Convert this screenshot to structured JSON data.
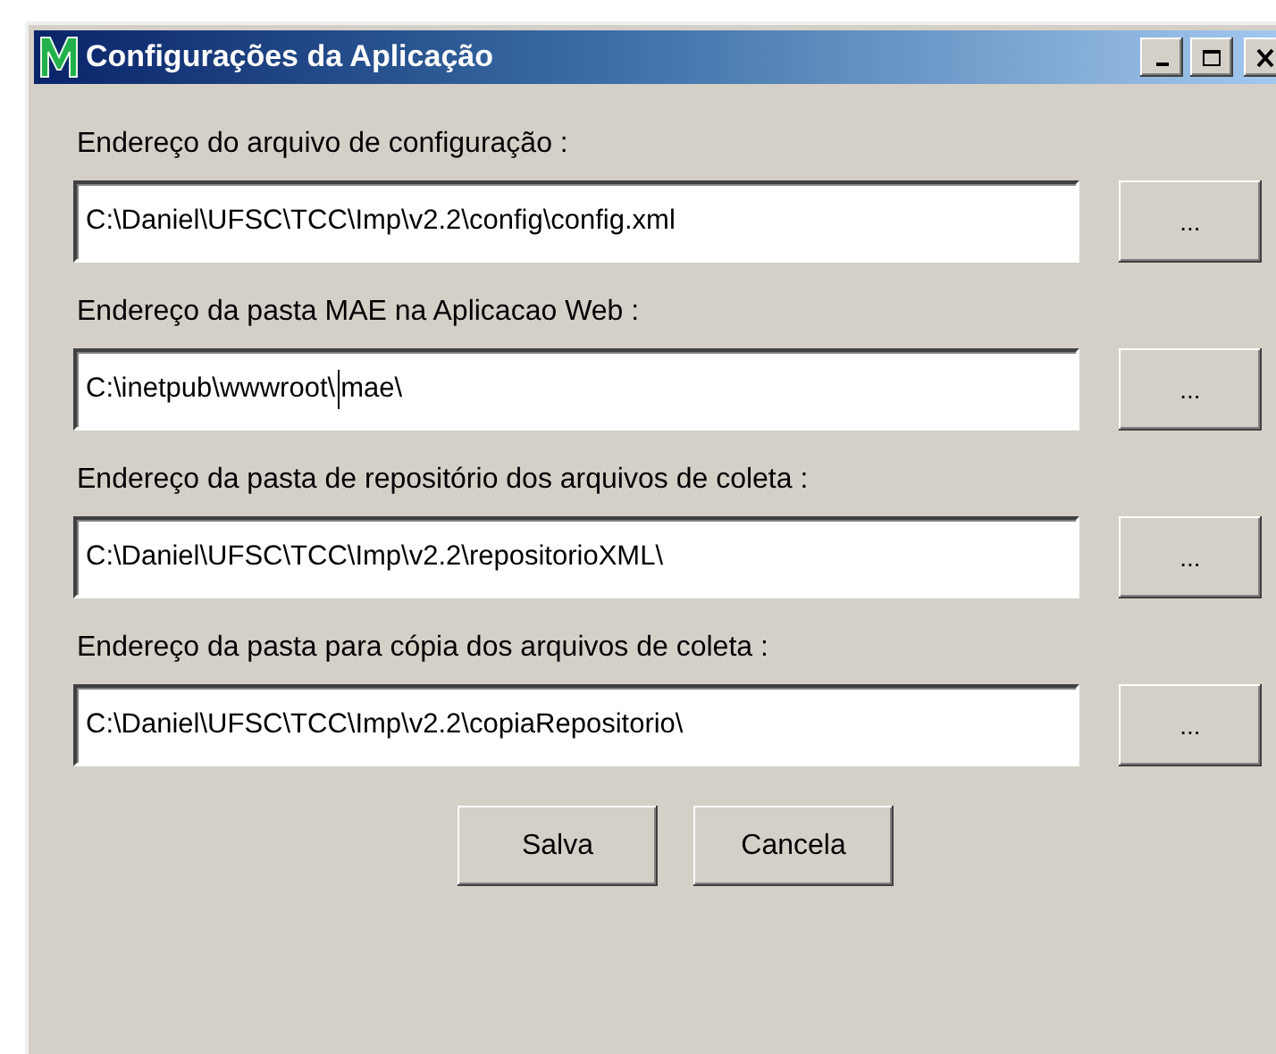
{
  "window": {
    "title": "Configurações da Aplicação"
  },
  "fields": [
    {
      "label": "Endereço do arquivo de configuração :",
      "value": "C:\\Daniel\\UFSC\\TCC\\Imp\\v2.2\\config\\config.xml",
      "browse": "...",
      "focused": false
    },
    {
      "label": "Endereço da pasta MAE na Aplicacao Web :",
      "value": "C:\\inetpub\\wwwroot\\mae\\",
      "browse": "...",
      "focused": true
    },
    {
      "label": "Endereço da pasta de repositório dos arquivos de coleta :",
      "value": "C:\\Daniel\\UFSC\\TCC\\Imp\\v2.2\\repositorioXML\\",
      "browse": "...",
      "focused": false
    },
    {
      "label": "Endereço da pasta para cópia dos arquivos de coleta :",
      "value": "C:\\Daniel\\UFSC\\TCC\\Imp\\v2.2\\copiaRepositorio\\",
      "browse": "...",
      "focused": false
    }
  ],
  "buttons": [
    "Salva",
    "Cancela"
  ]
}
